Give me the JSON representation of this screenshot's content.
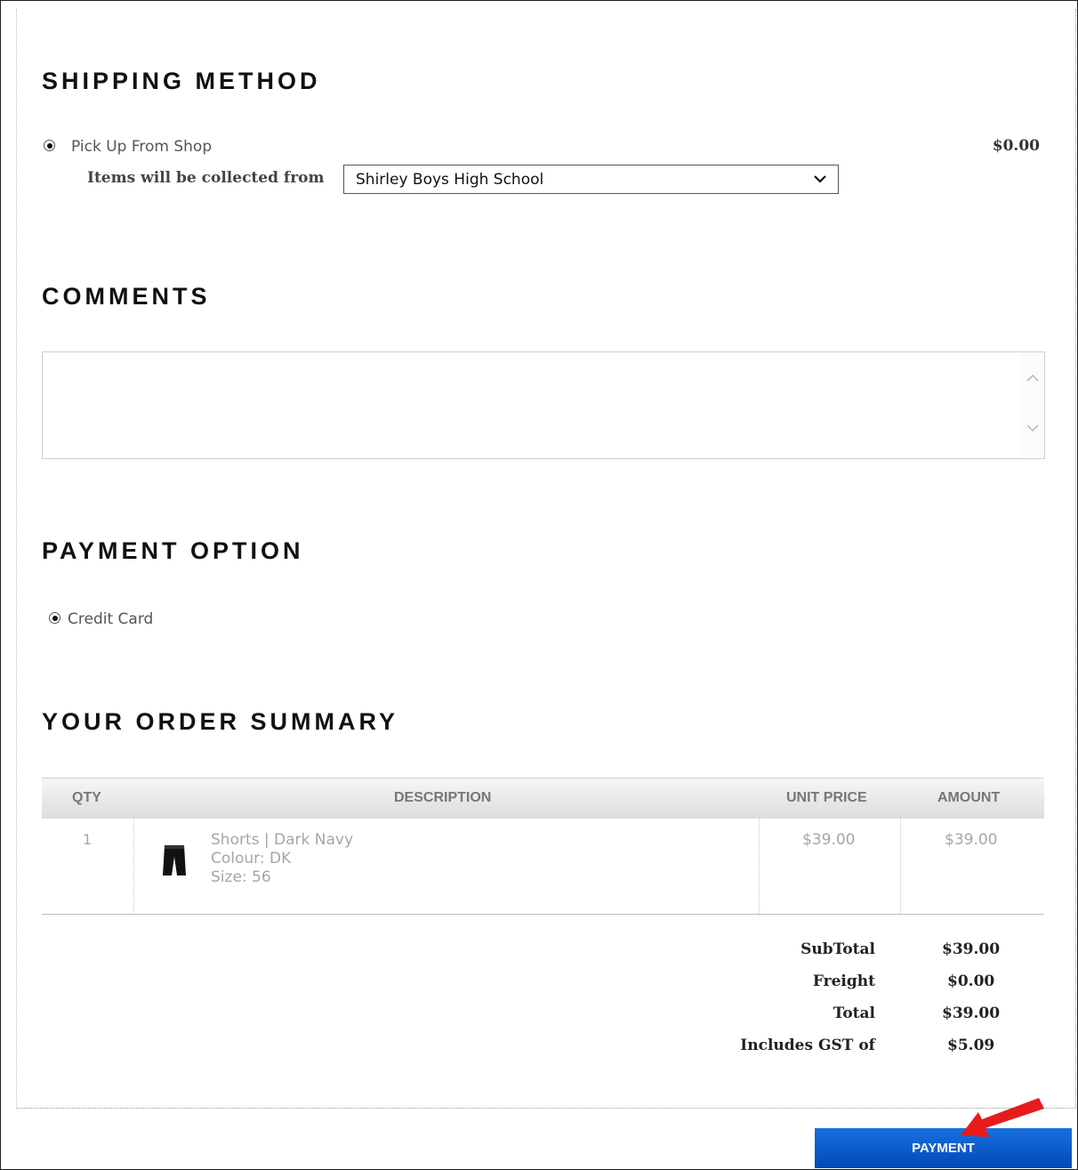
{
  "shipping": {
    "heading": "SHIPPING METHOD",
    "option_label": "Pick Up From Shop",
    "option_price": "$0.00",
    "collect_label": "Items will be collected from",
    "collect_value": "Shirley Boys High School"
  },
  "comments": {
    "heading": "COMMENTS",
    "value": ""
  },
  "payment": {
    "heading": "PAYMENT OPTION",
    "option_label": "Credit Card"
  },
  "summary": {
    "heading": "YOUR ORDER SUMMARY",
    "columns": [
      "QTY",
      "DESCRIPTION",
      "UNIT PRICE",
      "AMOUNT"
    ],
    "items": [
      {
        "qty": "1",
        "name": "Shorts | Dark Navy",
        "colour": "Colour: DK",
        "size": "Size: 56",
        "unit_price": "$39.00",
        "amount": "$39.00"
      }
    ],
    "totals": [
      {
        "label": "SubTotal",
        "value": "$39.00"
      },
      {
        "label": "Freight",
        "value": "$0.00"
      },
      {
        "label": "Total",
        "value": "$39.00"
      },
      {
        "label": "Includes GST of",
        "value": "$5.09"
      }
    ]
  },
  "actions": {
    "payment_button": "PAYMENT"
  },
  "colors": {
    "button_blue": "#0a5ad0",
    "arrow_red": "#e81b1b"
  },
  "icons": [
    "radio-selected",
    "chevron-down-icon",
    "scroll-up-icon",
    "scroll-down-icon",
    "shorts-thumbnail",
    "red-arrow-icon"
  ]
}
